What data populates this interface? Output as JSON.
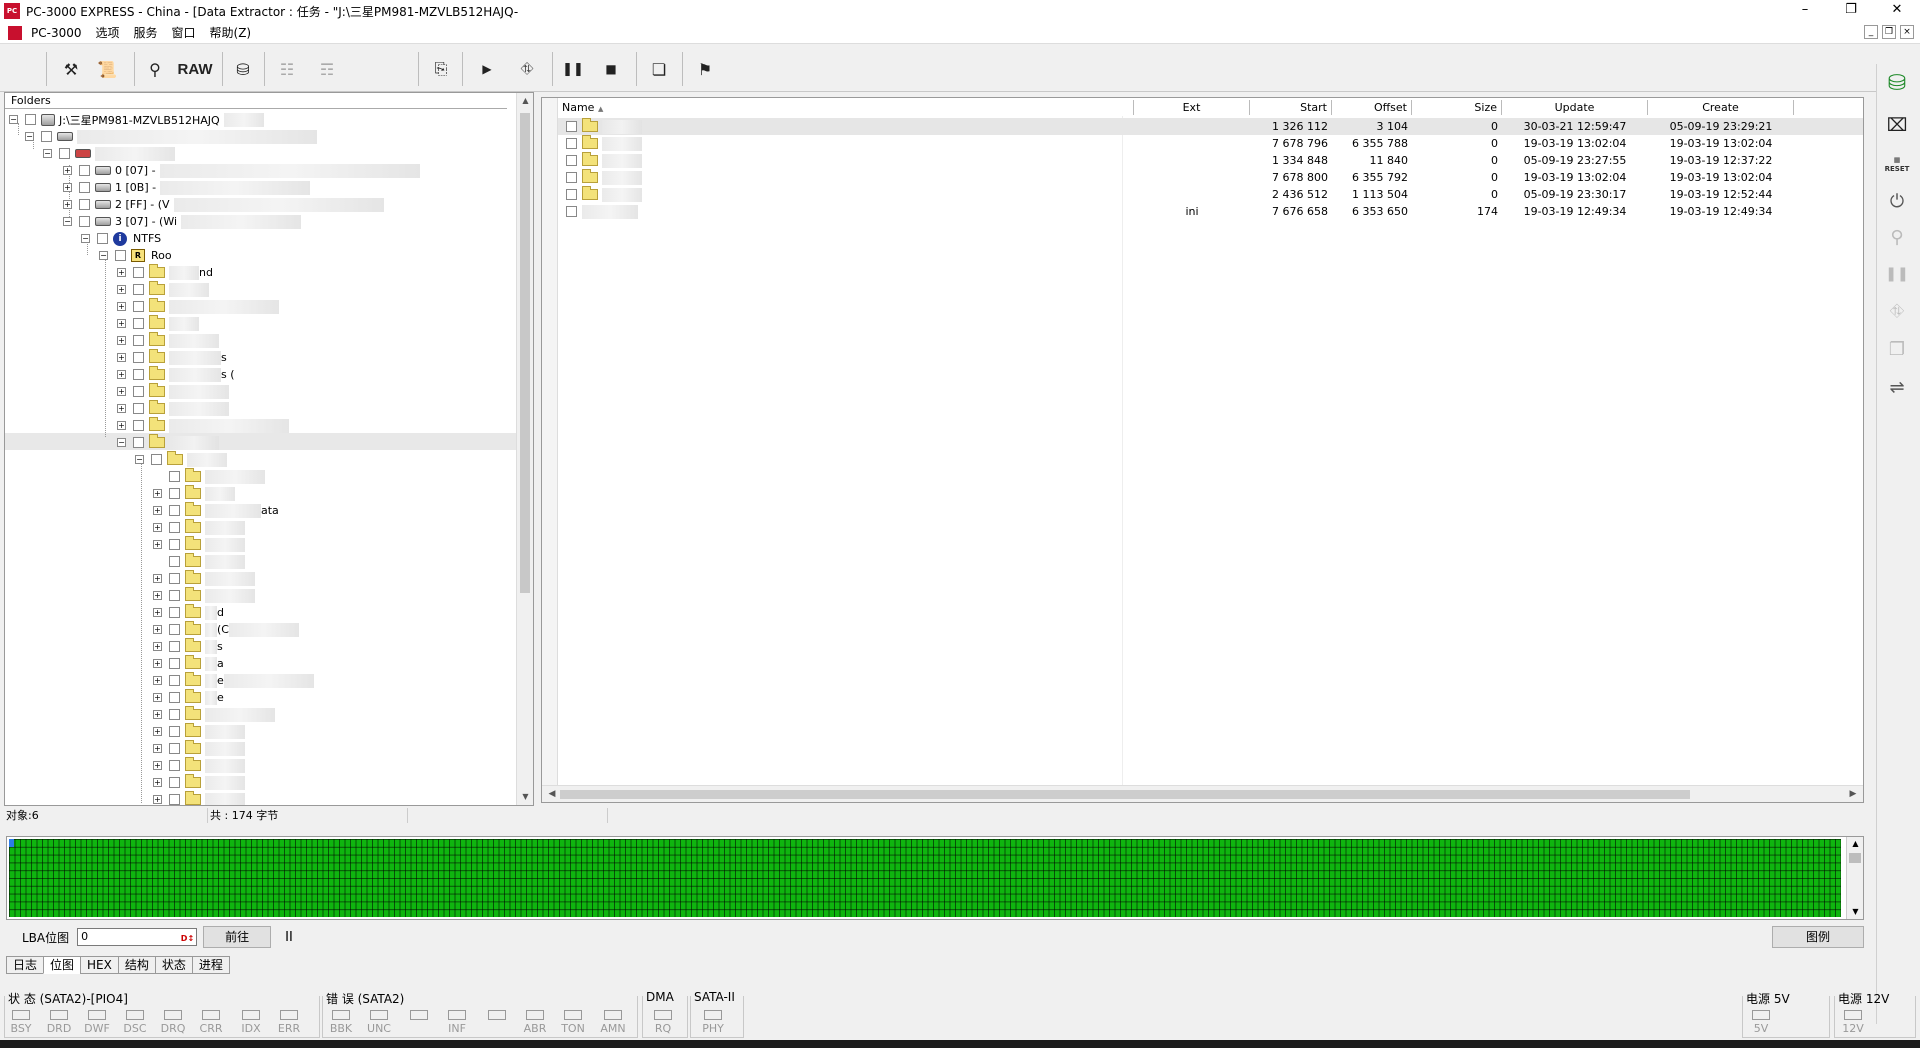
{
  "window": {
    "title": "PC-3000 EXPRESS - China - [Data Extractor : 任务 - \"J:\\三星PM981-MZVLB512HAJQ-",
    "app_badge": "PC"
  },
  "menu": [
    "PC-3000",
    "选项",
    "服务",
    "窗口",
    "帮助(Z)"
  ],
  "toolbar": {
    "raw_label": "RAW"
  },
  "tree": {
    "header": "Folders",
    "drive_label": "J:\\三星PM981-MZVLB512HAJQ",
    "partitions": [
      "0 [07] -",
      "1 [0B] -",
      "2 [FF] - (V",
      "3 [07] - (Wi"
    ],
    "fs_label": "NTFS",
    "root_label": "Roo",
    "fragments": [
      "nd",
      "s",
      "s (",
      "ata",
      "d",
      "(C",
      "s",
      "a",
      "e",
      "e"
    ]
  },
  "list": {
    "columns": [
      "Name",
      "Ext",
      "Start",
      "Offset",
      "Size",
      "Update",
      "Create"
    ],
    "rows": [
      {
        "ext": "",
        "start": "1 326 112",
        "offset": "3 104",
        "size": "0",
        "update": "30-03-21 12:59:47",
        "create": "05-09-19 23:29:21"
      },
      {
        "ext": "",
        "start": "7 678 796",
        "offset": "6 355 788",
        "size": "0",
        "update": "19-03-19 13:02:04",
        "create": "19-03-19 13:02:04"
      },
      {
        "ext": "",
        "start": "1 334 848",
        "offset": "11 840",
        "size": "0",
        "update": "05-09-19 23:27:55",
        "create": "19-03-19 12:37:22"
      },
      {
        "ext": "",
        "start": "7 678 800",
        "offset": "6 355 792",
        "size": "0",
        "update": "19-03-19 13:02:04",
        "create": "19-03-19 13:02:04"
      },
      {
        "ext": "",
        "start": "2 436 512",
        "offset": "1 113 504",
        "size": "0",
        "update": "05-09-19 23:30:17",
        "create": "19-03-19 12:52:44"
      },
      {
        "ext": "ini",
        "start": "7 676 658",
        "offset": "6 353 650",
        "size": "174",
        "update": "19-03-19 12:49:34",
        "create": "19-03-19 12:49:34"
      }
    ]
  },
  "status": {
    "objects": "对象:6",
    "total": "共 : 174 字节"
  },
  "lba": {
    "label": "LBA位图",
    "value": "0",
    "go": "前往",
    "pause": "II",
    "legend": "图例"
  },
  "tabs": [
    "日志",
    "位图",
    "HEX",
    "结构",
    "状态",
    "进程"
  ],
  "active_tab": "位图",
  "indicators": {
    "status_title": "状 态 (SATA2)-[PIO4]",
    "status_leds": [
      "BSY",
      "DRD",
      "DWF",
      "DSC",
      "DRQ",
      "CRR",
      "IDX",
      "ERR"
    ],
    "error_title": "错 误 (SATA2)",
    "error_leds": [
      "BBK",
      "UNC",
      "",
      "INF",
      "",
      "ABR",
      "TON",
      "AMN"
    ],
    "dma_title": "DMA",
    "dma_leds": [
      "RQ"
    ],
    "sata_title": "SATA-II",
    "sata_leds": [
      "PHY"
    ],
    "power5_title": "电源 5V",
    "power5_leds": [
      "5V"
    ],
    "power12_title": "电源 12V",
    "power12_leds": [
      "12V"
    ]
  }
}
